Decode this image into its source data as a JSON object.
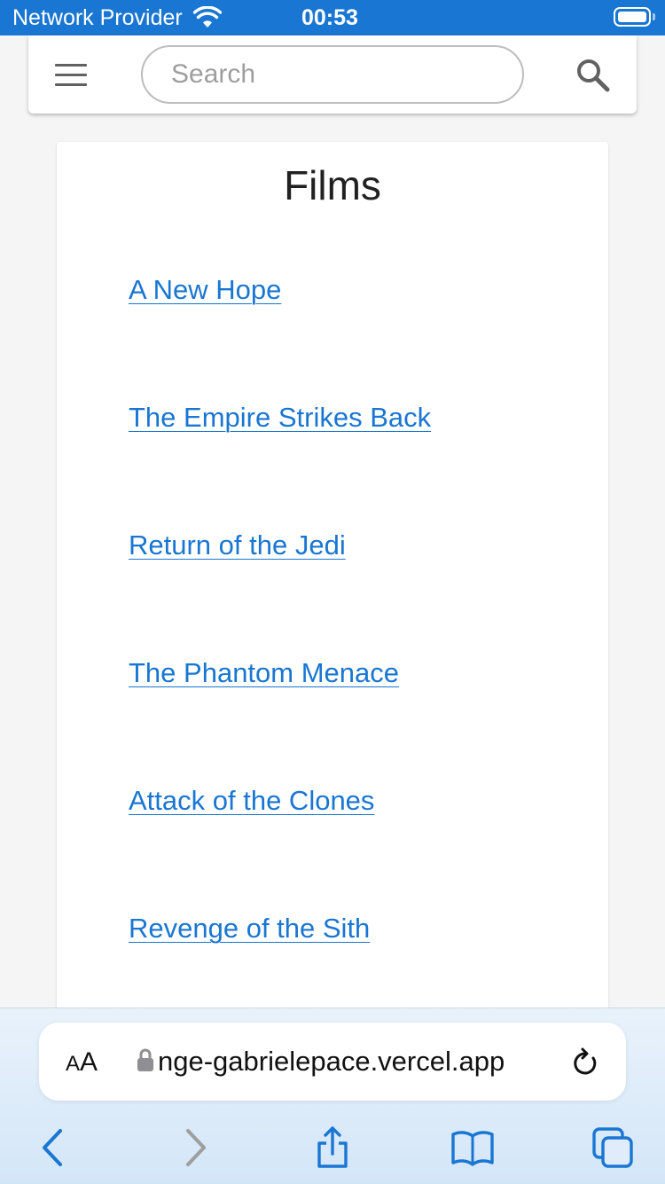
{
  "status_bar": {
    "carrier": "Network Provider",
    "time": "00:53",
    "icons": [
      "wifi-icon",
      "battery-icon"
    ]
  },
  "app_bar": {
    "menu_icon": "hamburger-menu-icon",
    "search": {
      "placeholder": "Search",
      "value": ""
    },
    "search_icon": "magnifier-icon"
  },
  "page": {
    "title": "Films",
    "films": [
      "A New Hope",
      "The Empire Strikes Back",
      "Return of the Jedi",
      "The Phantom Menace",
      "Attack of the Clones",
      "Revenge of the Sith"
    ]
  },
  "browser": {
    "text_size_label": {
      "small": "A",
      "large": "A"
    },
    "url": "nge-gabrielepace.vercel.app",
    "icons": [
      "lock-icon",
      "reload-icon",
      "back-icon",
      "forward-icon",
      "share-icon",
      "bookmarks-icon",
      "tabs-icon"
    ]
  },
  "colors": {
    "primary": "#1976d2",
    "link": "#1976d2",
    "text": "#212121",
    "background": "#f5f5f5"
  }
}
